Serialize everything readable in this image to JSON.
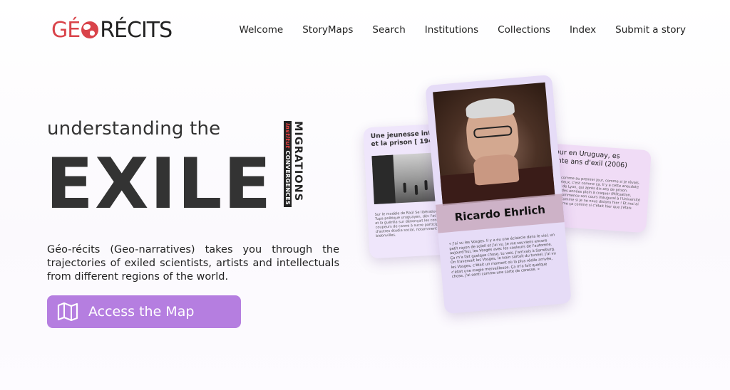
{
  "header": {
    "logo_part1": "GÉ",
    "logo_part2": "RÉCITS",
    "nav": [
      "Welcome",
      "StoryMaps",
      "Search",
      "Institutions",
      "Collections",
      "Index",
      "Submit a story"
    ]
  },
  "hero": {
    "subtitle": "understanding the",
    "headline": "EXILE",
    "badge_main": "MIGRATIONS",
    "badge_institut": "institut",
    "badge_sub": "CONVERGENCES",
    "description": "Géo-récits (Geo-narratives) takes you through the trajectories of exiled scientists, artists and intellectuals from different regions of the world.",
    "cta_label": "Access the Map"
  },
  "cards": {
    "left_title": "Une jeunesse interrom et la prison [ 1948 - 19",
    "left_body": "Sur le modèle de Raúl Se libération nationale-Tupa politique uruguayen, dév l'action directe et la guérilla sur dénonçait les conditions coupeurs de canne à sucre participe avec d'autres étudia social, notamment pour bidonvilles.",
    "right_title": "etour en Uruguay, es trente ans d'exil (2006)",
    "right_body": "m senti comme au premier jour, comme si je rêvais. C'est curieux, c'est comme ça. Il y a cette anecdote Mas Luis de Lyon, qui après dix ans de prison. Pendant des années plein à craquer (Mlituation, curieux commence son cours inaugural à l'Université on seul. Comme si je ne nous disions hier ! Et moi ai senti comme ça comme si c'était hier que j'étais",
    "center_name": "Ricardo Ehrlich",
    "center_body": "« J'ai vu les Vosges. Il y a eu une éclaircie dans le ciel, un petit rayon de soleil et j'ai vu. Je me souviens encore aujourd'hui, les Vosges avec les couleurs de l'automne. Ça m'a fait quelque chose, tu vois. J'arrivais à Sarreburg. On traversait les Vosges, le train sortait du tunnel. J'ai vu les Vosges, c'était un moment où la plus réelle arrivée, c'était une magie merveilleuse. Ça m'a fait quelque chose, j'ai senti comme une sorte de caresse. »"
  }
}
